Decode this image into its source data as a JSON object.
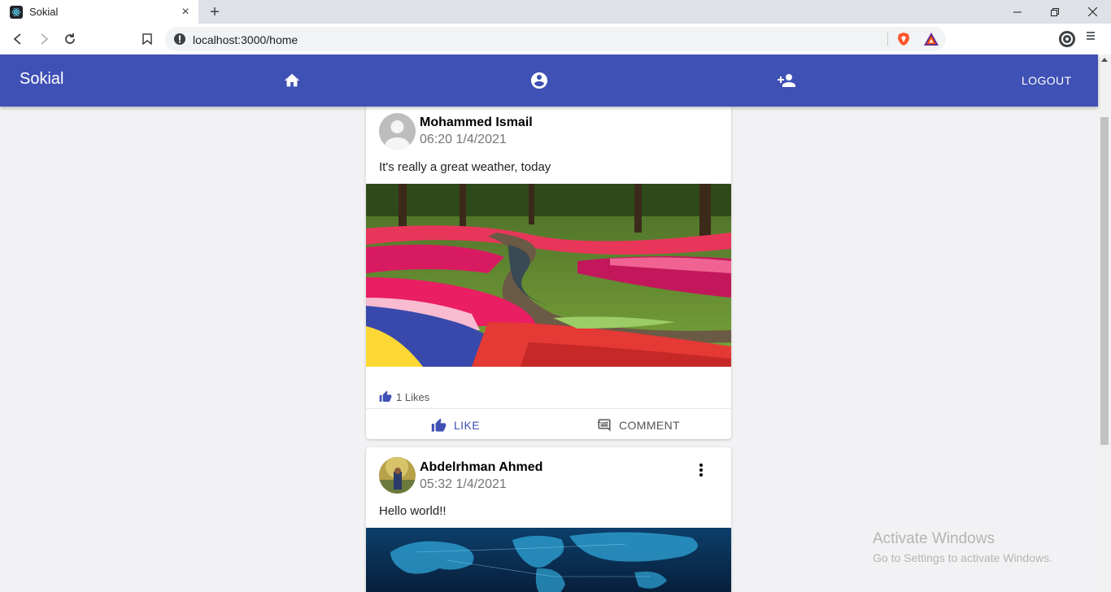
{
  "browser": {
    "tab_title": "Sokial",
    "url": "localhost:3000/home",
    "new_tab_symbol": "+",
    "close_symbol": "×"
  },
  "appbar": {
    "brand": "Sokial",
    "icons": [
      "home-icon",
      "account-circle-icon",
      "person-add-icon"
    ],
    "logout_label": "LOGOUT",
    "color": "#3f51b5"
  },
  "posts": [
    {
      "author": "Mohammed Ismail",
      "timestamp": "06:20 1/4/2021",
      "text": "It's really a great weather, today",
      "image": "flower-garden-photo",
      "likes_label": "1 Likes",
      "like_label": "LIKE",
      "comment_label": "COMMENT"
    },
    {
      "author": "Abdelrhman Ahmed",
      "timestamp": "05:32 1/4/2021",
      "text": "Hello world!!",
      "image": "world-map-photo"
    }
  ],
  "watermark": {
    "title": "Activate Windows",
    "subtitle": "Go to Settings to activate Windows."
  }
}
